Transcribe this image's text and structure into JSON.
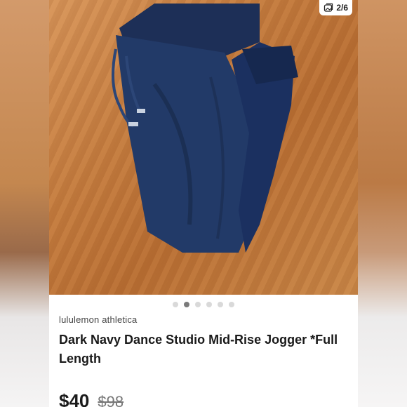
{
  "listing": {
    "image_counter": "2/6",
    "image_total": 6,
    "image_active_index": 1,
    "brand": "lululemon athletica",
    "title": "Dark Navy Dance Studio Mid-Rise Jogger *Full Length",
    "price": "$40",
    "original_price": "$98"
  },
  "icons": {
    "counter": "image-stack-icon"
  },
  "colors": {
    "garment": "#1f3560",
    "wood": "#c47c3f",
    "dot_active": "#7a7a7a",
    "dot_inactive": "#d9d9d9"
  }
}
